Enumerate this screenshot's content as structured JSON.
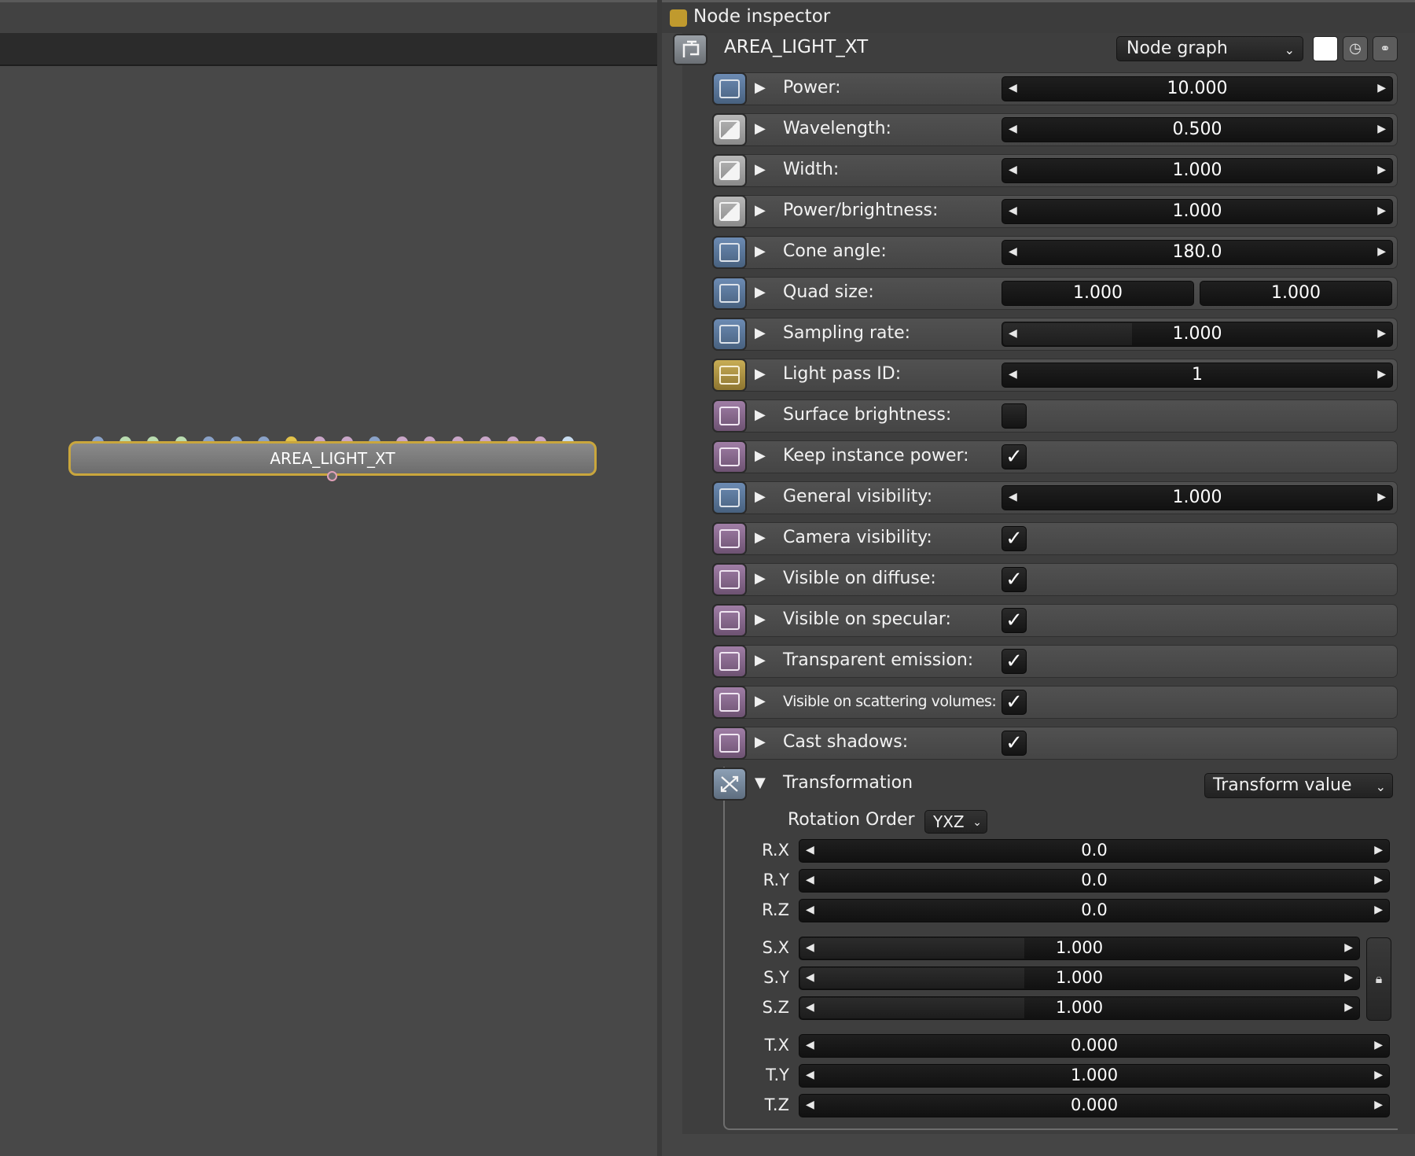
{
  "graph": {
    "node_title": "AREA_LIGHT_XT",
    "input_pin_colors": [
      "#8aa2c8",
      "#b9dcb0",
      "#b9dcb0",
      "#b9dcb0",
      "#8aa2c8",
      "#8aa2c8",
      "#8aa2c8",
      "#e2c24a",
      "#c9a6c8",
      "#c9a6c8",
      "#8aa2c8",
      "#c9a6c8",
      "#c9a6c8",
      "#c9a6c8",
      "#c9a6c8",
      "#c9a6c8",
      "#c9a6c8",
      "#c8dcf0"
    ]
  },
  "inspector": {
    "title": "Node inspector",
    "node_name": "AREA_LIGHT_XT",
    "graph_select": "Node graph",
    "icons": {
      "clock": "clock-icon",
      "link": "link-icon"
    }
  },
  "params": {
    "power": {
      "label": "Power:",
      "value": "10.000"
    },
    "wavelength": {
      "label": "Wavelength:",
      "value": "0.500"
    },
    "width": {
      "label": "Width:",
      "value": "1.000"
    },
    "power_brightness": {
      "label": "Power/brightness:",
      "value": "1.000"
    },
    "cone_angle": {
      "label": "Cone angle:",
      "value": "180.0"
    },
    "quad_size": {
      "label": "Quad size:",
      "value_x": "1.000",
      "value_y": "1.000"
    },
    "sampling_rate": {
      "label": "Sampling rate:",
      "value": "1.000",
      "fill": 0.33
    },
    "light_pass_id": {
      "label": "Light pass ID:",
      "value": "1"
    },
    "surface_brightness": {
      "label": "Surface brightness:",
      "checked": false
    },
    "keep_instance_power": {
      "label": "Keep instance power:",
      "checked": true
    },
    "general_visibility": {
      "label": "General visibility:",
      "value": "1.000"
    },
    "camera_visibility": {
      "label": "Camera visibility:",
      "checked": true
    },
    "visible_on_diffuse": {
      "label": "Visible on diffuse:",
      "checked": true
    },
    "visible_on_specular": {
      "label": "Visible on specular:",
      "checked": true
    },
    "transparent_emission": {
      "label": "Transparent emission:",
      "checked": true
    },
    "visible_on_scattering_volumes": {
      "label": "Visible on scattering volumes:",
      "checked": true
    },
    "cast_shadows": {
      "label": "Cast shadows:",
      "checked": true
    }
  },
  "check_glyph": "✓",
  "transformation": {
    "label": "Transformation",
    "mode_select": "Transform value",
    "rotation_order_label": "Rotation Order",
    "rotation_order": "YXZ",
    "rows": {
      "rx": {
        "label": "R.X",
        "value": "0.0"
      },
      "ry": {
        "label": "R.Y",
        "value": "0.0"
      },
      "rz": {
        "label": "R.Z",
        "value": "0.0"
      },
      "sx": {
        "label": "S.X",
        "value": "1.000",
        "fill": 0.4
      },
      "sy": {
        "label": "S.Y",
        "value": "1.000",
        "fill": 0.4
      },
      "sz": {
        "label": "S.Z",
        "value": "1.000",
        "fill": 0.4
      },
      "tx": {
        "label": "T.X",
        "value": "0.000"
      },
      "ty": {
        "label": "T.Y",
        "value": "1.000"
      },
      "tz": {
        "label": "T.Z",
        "value": "0.000"
      }
    }
  }
}
